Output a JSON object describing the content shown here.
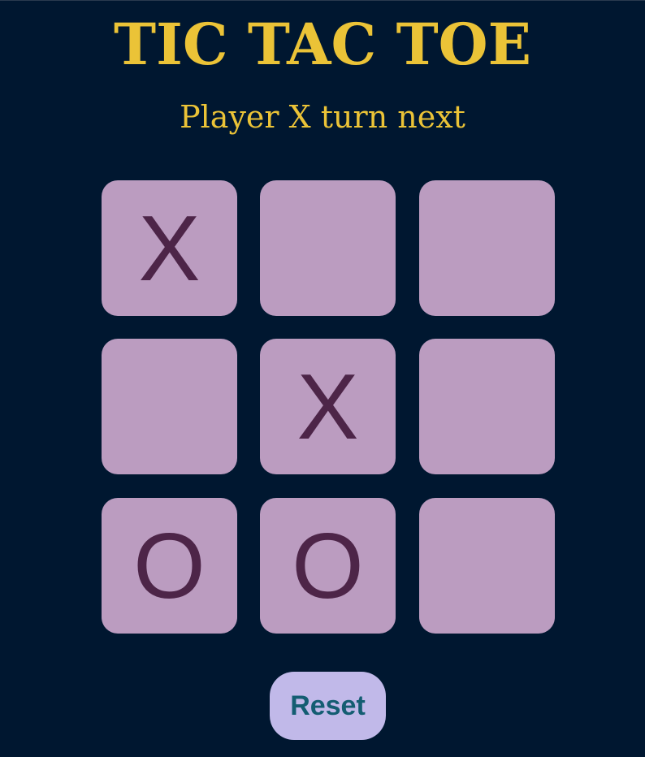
{
  "game": {
    "title": "TIC TAC TOE",
    "status": "Player X turn next",
    "board": [
      [
        "X",
        "",
        ""
      ],
      [
        "",
        "X",
        ""
      ],
      [
        "O",
        "O",
        ""
      ]
    ],
    "reset_label": "Reset"
  },
  "colors": {
    "background": "#001730",
    "title": "#ebc337",
    "cell": "#bb9cc0",
    "mark": "#4d2548",
    "reset_bg": "#c1b9e9",
    "reset_text": "#145d72"
  }
}
